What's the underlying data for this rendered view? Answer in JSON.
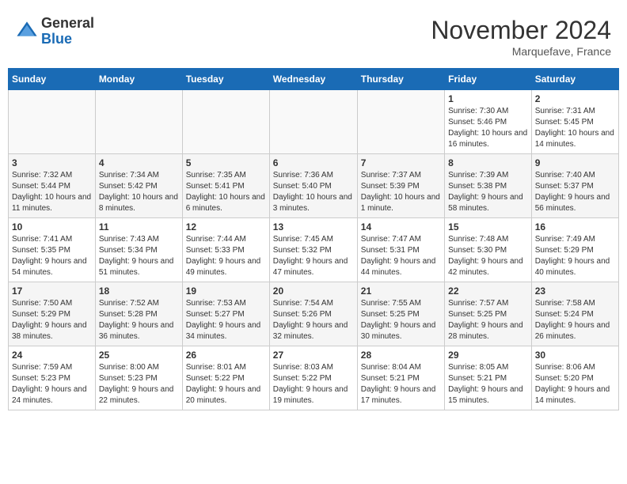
{
  "logo": {
    "general": "General",
    "blue": "Blue"
  },
  "header": {
    "month": "November 2024",
    "location": "Marquefave, France"
  },
  "weekdays": [
    "Sunday",
    "Monday",
    "Tuesday",
    "Wednesday",
    "Thursday",
    "Friday",
    "Saturday"
  ],
  "weeks": [
    [
      {
        "day": "",
        "info": ""
      },
      {
        "day": "",
        "info": ""
      },
      {
        "day": "",
        "info": ""
      },
      {
        "day": "",
        "info": ""
      },
      {
        "day": "",
        "info": ""
      },
      {
        "day": "1",
        "info": "Sunrise: 7:30 AM\nSunset: 5:46 PM\nDaylight: 10 hours and 16 minutes."
      },
      {
        "day": "2",
        "info": "Sunrise: 7:31 AM\nSunset: 5:45 PM\nDaylight: 10 hours and 14 minutes."
      }
    ],
    [
      {
        "day": "3",
        "info": "Sunrise: 7:32 AM\nSunset: 5:44 PM\nDaylight: 10 hours and 11 minutes."
      },
      {
        "day": "4",
        "info": "Sunrise: 7:34 AM\nSunset: 5:42 PM\nDaylight: 10 hours and 8 minutes."
      },
      {
        "day": "5",
        "info": "Sunrise: 7:35 AM\nSunset: 5:41 PM\nDaylight: 10 hours and 6 minutes."
      },
      {
        "day": "6",
        "info": "Sunrise: 7:36 AM\nSunset: 5:40 PM\nDaylight: 10 hours and 3 minutes."
      },
      {
        "day": "7",
        "info": "Sunrise: 7:37 AM\nSunset: 5:39 PM\nDaylight: 10 hours and 1 minute."
      },
      {
        "day": "8",
        "info": "Sunrise: 7:39 AM\nSunset: 5:38 PM\nDaylight: 9 hours and 58 minutes."
      },
      {
        "day": "9",
        "info": "Sunrise: 7:40 AM\nSunset: 5:37 PM\nDaylight: 9 hours and 56 minutes."
      }
    ],
    [
      {
        "day": "10",
        "info": "Sunrise: 7:41 AM\nSunset: 5:35 PM\nDaylight: 9 hours and 54 minutes."
      },
      {
        "day": "11",
        "info": "Sunrise: 7:43 AM\nSunset: 5:34 PM\nDaylight: 9 hours and 51 minutes."
      },
      {
        "day": "12",
        "info": "Sunrise: 7:44 AM\nSunset: 5:33 PM\nDaylight: 9 hours and 49 minutes."
      },
      {
        "day": "13",
        "info": "Sunrise: 7:45 AM\nSunset: 5:32 PM\nDaylight: 9 hours and 47 minutes."
      },
      {
        "day": "14",
        "info": "Sunrise: 7:47 AM\nSunset: 5:31 PM\nDaylight: 9 hours and 44 minutes."
      },
      {
        "day": "15",
        "info": "Sunrise: 7:48 AM\nSunset: 5:30 PM\nDaylight: 9 hours and 42 minutes."
      },
      {
        "day": "16",
        "info": "Sunrise: 7:49 AM\nSunset: 5:29 PM\nDaylight: 9 hours and 40 minutes."
      }
    ],
    [
      {
        "day": "17",
        "info": "Sunrise: 7:50 AM\nSunset: 5:29 PM\nDaylight: 9 hours and 38 minutes."
      },
      {
        "day": "18",
        "info": "Sunrise: 7:52 AM\nSunset: 5:28 PM\nDaylight: 9 hours and 36 minutes."
      },
      {
        "day": "19",
        "info": "Sunrise: 7:53 AM\nSunset: 5:27 PM\nDaylight: 9 hours and 34 minutes."
      },
      {
        "day": "20",
        "info": "Sunrise: 7:54 AM\nSunset: 5:26 PM\nDaylight: 9 hours and 32 minutes."
      },
      {
        "day": "21",
        "info": "Sunrise: 7:55 AM\nSunset: 5:25 PM\nDaylight: 9 hours and 30 minutes."
      },
      {
        "day": "22",
        "info": "Sunrise: 7:57 AM\nSunset: 5:25 PM\nDaylight: 9 hours and 28 minutes."
      },
      {
        "day": "23",
        "info": "Sunrise: 7:58 AM\nSunset: 5:24 PM\nDaylight: 9 hours and 26 minutes."
      }
    ],
    [
      {
        "day": "24",
        "info": "Sunrise: 7:59 AM\nSunset: 5:23 PM\nDaylight: 9 hours and 24 minutes."
      },
      {
        "day": "25",
        "info": "Sunrise: 8:00 AM\nSunset: 5:23 PM\nDaylight: 9 hours and 22 minutes."
      },
      {
        "day": "26",
        "info": "Sunrise: 8:01 AM\nSunset: 5:22 PM\nDaylight: 9 hours and 20 minutes."
      },
      {
        "day": "27",
        "info": "Sunrise: 8:03 AM\nSunset: 5:22 PM\nDaylight: 9 hours and 19 minutes."
      },
      {
        "day": "28",
        "info": "Sunrise: 8:04 AM\nSunset: 5:21 PM\nDaylight: 9 hours and 17 minutes."
      },
      {
        "day": "29",
        "info": "Sunrise: 8:05 AM\nSunset: 5:21 PM\nDaylight: 9 hours and 15 minutes."
      },
      {
        "day": "30",
        "info": "Sunrise: 8:06 AM\nSunset: 5:20 PM\nDaylight: 9 hours and 14 minutes."
      }
    ]
  ]
}
